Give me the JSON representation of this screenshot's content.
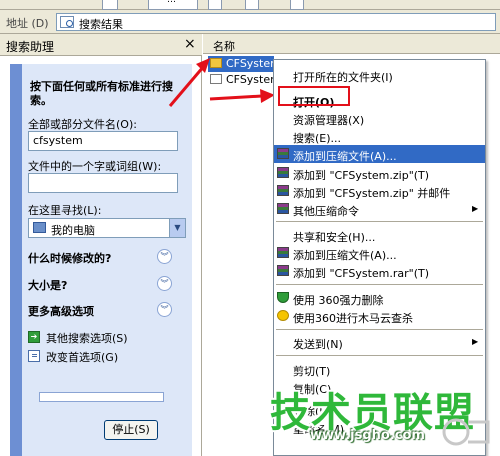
{
  "toolbar": {
    "partial_label": "…"
  },
  "address_bar": {
    "label": "地址 (D)",
    "value": "搜索结果"
  },
  "search_pane": {
    "title": "搜索助理",
    "close": "×",
    "heading": "按下面任何或所有标准进行搜索。",
    "filename_label": "全部或部分文件名(O):",
    "filename_value": "cfsystem",
    "phrase_label": "文件中的一个字或词组(W):",
    "phrase_value": "",
    "look_in_label": "在这里寻找(L):",
    "look_in_value": "我的电脑",
    "when_modified": "什么时候修改的?",
    "size": "大小是?",
    "advanced": "更多高级选项",
    "other_options": "其他搜索选项(S)",
    "change_prefs": "改变首选项(G)",
    "stop_label": "停止(S)"
  },
  "file_list": {
    "column_name": "名称",
    "rows": [
      {
        "name": "CFSystem"
      },
      {
        "name": "CFSystem"
      }
    ]
  },
  "context_menu": {
    "items": [
      "打开所在的文件夹(I)",
      "打开(O)",
      "资源管理器(X)",
      "搜索(E)...",
      "添加到压缩文件(A)...",
      "添加到 \"CFSystem.zip\"(T)",
      "添加到 \"CFSystem.zip\" 并邮件",
      "其他压缩命令",
      "共享和安全(H)...",
      "添加到压缩文件(A)...",
      "添加到 \"CFSystem.rar\"(T)",
      "使用 360强力删除",
      "使用360进行木马云查杀",
      "发送到(N)",
      "剪切(T)",
      "复制(C)",
      "删除(D)",
      "重命名(M)"
    ]
  },
  "watermark": {
    "brand": "技术员联盟",
    "url": "www.jsgho.com"
  },
  "colors": {
    "selection": "#316ac5",
    "annotation_red": "#e3101a",
    "pane_blue": "#6d8fd3",
    "watermark_green": "#2fb83a"
  }
}
